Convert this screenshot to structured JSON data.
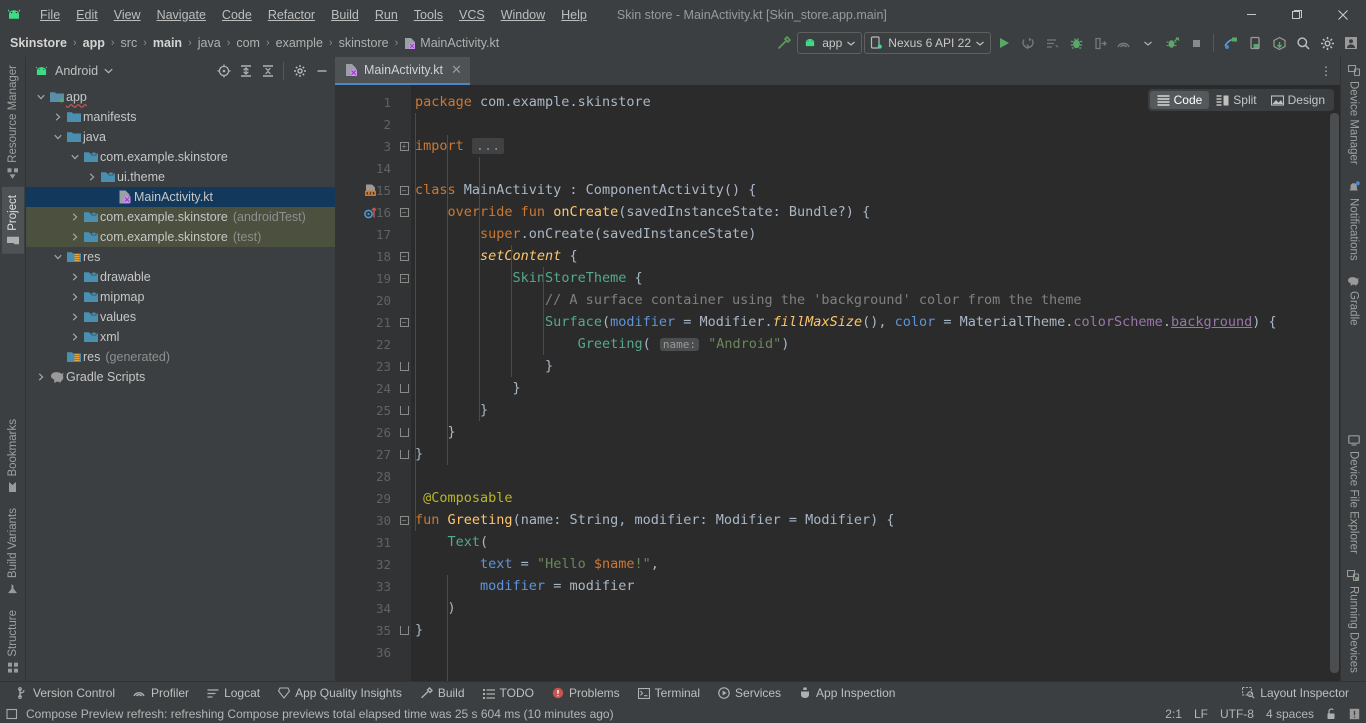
{
  "window": {
    "title": "Skin store - MainActivity.kt [Skin_store.app.main]",
    "minimize": "—",
    "maximize": "❐",
    "close": "✕"
  },
  "menu": {
    "items": [
      "File",
      "Edit",
      "View",
      "Navigate",
      "Code",
      "Refactor",
      "Build",
      "Run",
      "Tools",
      "VCS",
      "Window",
      "Help"
    ]
  },
  "breadcrumb": {
    "items": [
      {
        "label": "Skinstore",
        "bold": true
      },
      {
        "label": "app",
        "bold": true
      },
      {
        "label": "src",
        "bold": false
      },
      {
        "label": "main",
        "bold": true
      },
      {
        "label": "java",
        "bold": false
      },
      {
        "label": "com",
        "bold": false
      },
      {
        "label": "example",
        "bold": false
      },
      {
        "label": "skinstore",
        "bold": false
      }
    ],
    "file": "MainActivity.kt",
    "separator": "›"
  },
  "toolbar": {
    "build_hammer": "build-hammer-icon",
    "run_config": "app",
    "device": "Nexus 6 API 22",
    "run": "run-button",
    "apply_changes": "apply-changes-button",
    "apply_code_changes": "apply-code-changes-button",
    "debug": "debug-button",
    "attach_debugger": "attach-debugger-button",
    "profile": "profiler-button",
    "run_with_coverage": "run-coverage-button",
    "stop": "stop-button",
    "layout_inspector_tb": "layout-inspector-button",
    "device_mirror": "device-mirroring-button",
    "logcat_tb": "sdk-manager-button",
    "search": "search-icon",
    "settings": "gear-icon",
    "account": "account-icon"
  },
  "left_strip": {
    "tabs": [
      {
        "label": "Resource Manager",
        "icon": "resource-manager-icon",
        "active": false
      },
      {
        "label": "Project",
        "icon": "project-folder-icon",
        "active": true
      },
      {
        "label": "Bookmarks",
        "icon": "bookmark-icon",
        "active": false
      },
      {
        "label": "Build Variants",
        "icon": "build-variants-icon",
        "active": false
      },
      {
        "label": "Structure",
        "icon": "structure-icon",
        "active": false
      }
    ]
  },
  "right_strip": {
    "tabs": [
      {
        "label": "Device Manager",
        "icon": "device-manager-icon"
      },
      {
        "label": "Notifications",
        "icon": "notifications-bell-icon"
      },
      {
        "label": "Gradle",
        "icon": "gradle-elephant-icon"
      },
      {
        "label": "Device File Explorer",
        "icon": "device-file-explorer-icon"
      },
      {
        "label": "Running Devices",
        "icon": "running-devices-icon"
      }
    ]
  },
  "project_panel": {
    "title": "Android",
    "dropdown_icon": "chevron-down-icon",
    "actions": [
      "select-opened-file-icon",
      "expand-all-icon",
      "collapse-all-icon",
      "settings-gear-icon",
      "hide-icon"
    ],
    "tree": [
      {
        "label": "app",
        "indent": 0,
        "arrow": "down",
        "icon": "module-icon",
        "state": "normal",
        "squiggle": true
      },
      {
        "label": "manifests",
        "indent": 1,
        "arrow": "right",
        "icon": "folder-icon",
        "state": "normal"
      },
      {
        "label": "java",
        "indent": 1,
        "arrow": "down",
        "icon": "folder-icon",
        "state": "normal"
      },
      {
        "label": "com.example.skinstore",
        "indent": 2,
        "arrow": "down",
        "icon": "package-icon",
        "state": "normal"
      },
      {
        "label": "ui.theme",
        "indent": 3,
        "arrow": "right",
        "icon": "package-icon",
        "state": "normal"
      },
      {
        "label": "MainActivity.kt",
        "indent": 4,
        "arrow": "none",
        "icon": "kotlin-class-icon",
        "state": "selected"
      },
      {
        "label": "com.example.skinstore",
        "sub": "(androidTest)",
        "indent": 2,
        "arrow": "right",
        "icon": "package-icon",
        "state": "testsrc"
      },
      {
        "label": "com.example.skinstore",
        "sub": "(test)",
        "indent": 2,
        "arrow": "right",
        "icon": "package-icon",
        "state": "testsrc"
      },
      {
        "label": "res",
        "indent": 1,
        "arrow": "down",
        "icon": "res-folder-icon",
        "state": "normal"
      },
      {
        "label": "drawable",
        "indent": 2,
        "arrow": "right",
        "icon": "package-icon",
        "state": "normal"
      },
      {
        "label": "mipmap",
        "indent": 2,
        "arrow": "right",
        "icon": "package-icon",
        "state": "normal"
      },
      {
        "label": "values",
        "indent": 2,
        "arrow": "right",
        "icon": "package-icon",
        "state": "normal"
      },
      {
        "label": "xml",
        "indent": 2,
        "arrow": "right",
        "icon": "package-icon",
        "state": "normal"
      },
      {
        "label": "res",
        "sub": "(generated)",
        "indent": 1,
        "arrow": "none",
        "icon": "res-folder-icon",
        "state": "normal"
      },
      {
        "label": "Gradle Scripts",
        "indent": 0,
        "arrow": "right",
        "icon": "gradle-elephant-icon",
        "state": "normal"
      }
    ]
  },
  "editor": {
    "tab": {
      "label": "MainActivity.kt",
      "icon": "kotlin-class-icon",
      "close": "✕"
    },
    "kebab": "⋮",
    "view_modes": [
      {
        "label": "Code",
        "icon": "code-lines-icon",
        "active": true
      },
      {
        "label": "Split",
        "icon": "split-view-icon",
        "active": false
      },
      {
        "label": "Design",
        "icon": "design-view-icon",
        "active": false
      }
    ],
    "inspection_status": "✔",
    "line_numbers": [
      1,
      2,
      3,
      14,
      15,
      16,
      17,
      18,
      19,
      20,
      21,
      22,
      23,
      24,
      25,
      26,
      27,
      28,
      29,
      30,
      31,
      32,
      33,
      34,
      35,
      36
    ],
    "gutter_icons": [
      {
        "line_index": 4,
        "name": "compose-preview-icon"
      },
      {
        "line_index": 5,
        "name": "override-method-icon"
      }
    ],
    "code_lines": [
      {
        "n": 1,
        "tokens": [
          {
            "t": "package",
            "c": "kw"
          },
          {
            "t": " com.example.skinstore",
            "c": "plain"
          }
        ]
      },
      {
        "n": 2,
        "tokens": []
      },
      {
        "n": 3,
        "tokens": [
          {
            "t": "import",
            "c": "kw"
          },
          {
            "t": " ",
            "c": "plain"
          },
          {
            "t": "...",
            "c": "fold"
          }
        ]
      },
      {
        "n": 14,
        "tokens": []
      },
      {
        "n": 15,
        "tokens": [
          {
            "t": "class",
            "c": "kw"
          },
          {
            "t": " MainActivity : ComponentActivity() {",
            "c": "plain"
          }
        ]
      },
      {
        "n": 16,
        "tokens": [
          {
            "t": "    ",
            "c": "plain"
          },
          {
            "t": "override fun",
            "c": "kw"
          },
          {
            "t": " ",
            "c": "plain"
          },
          {
            "t": "onCreate",
            "c": "fnd"
          },
          {
            "t": "(savedInstanceState: Bundle?) {",
            "c": "plain"
          }
        ]
      },
      {
        "n": 17,
        "tokens": [
          {
            "t": "        ",
            "c": "plain"
          },
          {
            "t": "super",
            "c": "kw"
          },
          {
            "t": ".onCreate(savedInstanceState)",
            "c": "plain"
          }
        ]
      },
      {
        "n": 18,
        "tokens": [
          {
            "t": "        ",
            "c": "plain"
          },
          {
            "t": "setContent",
            "c": "italic"
          },
          {
            "t": " {",
            "c": "plain"
          }
        ]
      },
      {
        "n": 19,
        "tokens": [
          {
            "t": "            ",
            "c": "plain"
          },
          {
            "t": "SkinStoreTheme",
            "c": "fn"
          },
          {
            "t": " {",
            "c": "plain"
          }
        ]
      },
      {
        "n": 20,
        "tokens": [
          {
            "t": "                ",
            "c": "plain"
          },
          {
            "t": "// A surface container using the 'background' color from the theme",
            "c": "com"
          }
        ]
      },
      {
        "n": 21,
        "tokens": [
          {
            "t": "                ",
            "c": "plain"
          },
          {
            "t": "Surface",
            "c": "fn"
          },
          {
            "t": "(",
            "c": "plain"
          },
          {
            "t": "modifier",
            "c": "param"
          },
          {
            "t": " = Modifier.",
            "c": "plain"
          },
          {
            "t": "fillMaxSize",
            "c": "italic"
          },
          {
            "t": "(), ",
            "c": "plain"
          },
          {
            "t": "color",
            "c": "param"
          },
          {
            "t": " = MaterialTheme.",
            "c": "plain"
          },
          {
            "t": "colorScheme",
            "c": "prop"
          },
          {
            "t": ".",
            "c": "plain"
          },
          {
            "t": "background",
            "c": "prop-u"
          },
          {
            "t": ") {",
            "c": "plain"
          }
        ]
      },
      {
        "n": 22,
        "tokens": [
          {
            "t": "                    ",
            "c": "plain"
          },
          {
            "t": "Greeting",
            "c": "fn"
          },
          {
            "t": "( ",
            "c": "plain"
          },
          {
            "t": "name:",
            "c": "hint"
          },
          {
            "t": " ",
            "c": "plain"
          },
          {
            "t": "\"Android\"",
            "c": "str"
          },
          {
            "t": ")",
            "c": "plain"
          }
        ]
      },
      {
        "n": 23,
        "tokens": [
          {
            "t": "                }",
            "c": "plain"
          }
        ]
      },
      {
        "n": 24,
        "tokens": [
          {
            "t": "            }",
            "c": "plain"
          }
        ]
      },
      {
        "n": 25,
        "tokens": [
          {
            "t": "        }",
            "c": "plain"
          }
        ]
      },
      {
        "n": 26,
        "tokens": [
          {
            "t": "    }",
            "c": "plain"
          }
        ]
      },
      {
        "n": 27,
        "tokens": [
          {
            "t": "}",
            "c": "plain"
          }
        ]
      },
      {
        "n": 28,
        "tokens": []
      },
      {
        "n": 29,
        "tokens": [
          {
            "t": " ",
            "c": "plain"
          },
          {
            "t": "@Composable",
            "c": "ann"
          }
        ]
      },
      {
        "n": 30,
        "tokens": [
          {
            "t": "fun",
            "c": "kw"
          },
          {
            "t": " ",
            "c": "plain"
          },
          {
            "t": "Greeting",
            "c": "fnd"
          },
          {
            "t": "(name: String, modifier: Modifier = Modifier) {",
            "c": "plain"
          }
        ]
      },
      {
        "n": 31,
        "tokens": [
          {
            "t": "    ",
            "c": "plain"
          },
          {
            "t": "Text",
            "c": "fn"
          },
          {
            "t": "(",
            "c": "plain"
          }
        ]
      },
      {
        "n": 32,
        "tokens": [
          {
            "t": "        ",
            "c": "plain"
          },
          {
            "t": "text",
            "c": "param"
          },
          {
            "t": " = ",
            "c": "plain"
          },
          {
            "t": "\"Hello ",
            "c": "str"
          },
          {
            "t": "$name",
            "c": "templ"
          },
          {
            "t": "!\"",
            "c": "str"
          },
          {
            "t": ",",
            "c": "plain"
          }
        ]
      },
      {
        "n": 33,
        "tokens": [
          {
            "t": "        ",
            "c": "plain"
          },
          {
            "t": "modifier",
            "c": "param"
          },
          {
            "t": " = modifier",
            "c": "plain"
          }
        ]
      },
      {
        "n": 34,
        "tokens": [
          {
            "t": "    )",
            "c": "plain"
          }
        ]
      },
      {
        "n": 35,
        "tokens": [
          {
            "t": "}",
            "c": "plain"
          }
        ]
      },
      {
        "n": 36,
        "tokens": []
      }
    ]
  },
  "tool_windows": {
    "items": [
      {
        "label": "Version Control",
        "icon": "branch-icon"
      },
      {
        "label": "Profiler",
        "icon": "profiler-icon"
      },
      {
        "label": "Logcat",
        "icon": "logcat-icon"
      },
      {
        "label": "App Quality Insights",
        "icon": "quality-insights-icon"
      },
      {
        "label": "Build",
        "icon": "build-hammer-icon"
      },
      {
        "label": "TODO",
        "icon": "todo-list-icon"
      },
      {
        "label": "Problems",
        "icon": "problems-error-icon"
      },
      {
        "label": "Terminal",
        "icon": "terminal-icon"
      },
      {
        "label": "Services",
        "icon": "services-icon"
      },
      {
        "label": "App Inspection",
        "icon": "app-inspection-icon"
      }
    ],
    "right": {
      "label": "Layout Inspector",
      "icon": "layout-inspector-icon"
    }
  },
  "status": {
    "message_icon": "background-tasks-icon",
    "message": "Compose Preview refresh: refreshing Compose previews total elapsed time was 25 s 604 ms (10 minutes ago)",
    "caret": "2:1",
    "line_separator": "LF",
    "encoding": "UTF-8",
    "indent": "4 spaces",
    "lock": "read-only-lock-icon",
    "notifications": "notification-icon"
  },
  "colors": {
    "accent_blue": "#4a88c7",
    "selection_blue": "#12395c",
    "test_green": "#4b503f",
    "keyword_orange": "#cc7832",
    "string_green": "#6a8759",
    "comment_gray": "#808080",
    "function_teal": "#54a98c",
    "param_blue": "#5f94d9",
    "annotation_yellow": "#bbb529",
    "property_purple": "#9876aa",
    "declaration_yellow": "#ffc66d",
    "android_green": "#3ddc84",
    "editor_bg": "#2b2b2b",
    "chrome_bg": "#3c3f41"
  }
}
